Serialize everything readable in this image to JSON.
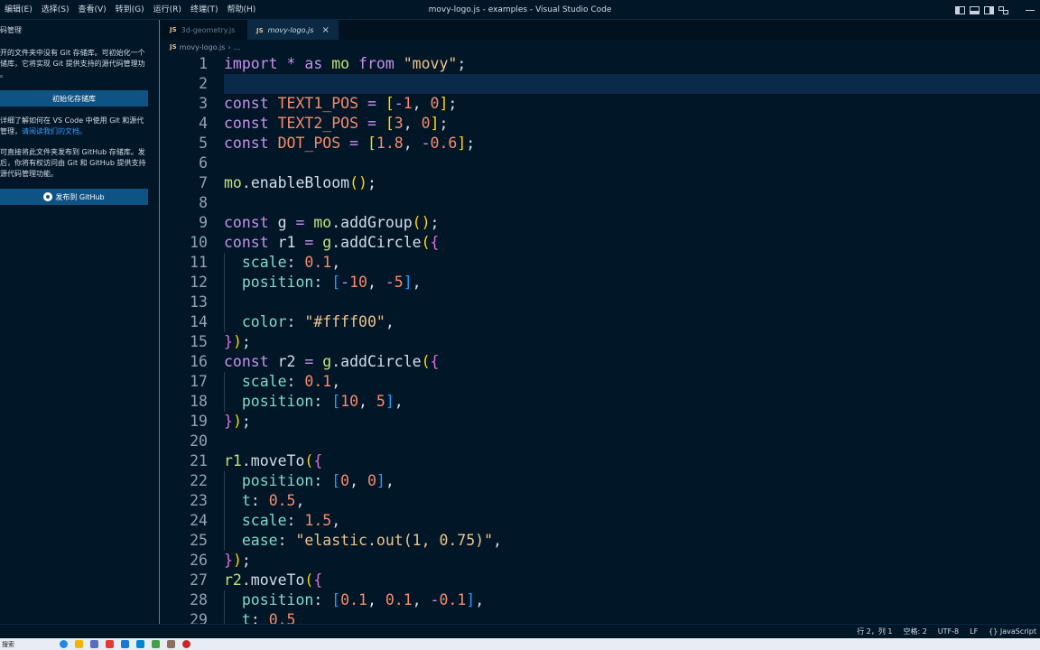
{
  "menu": [
    "编辑(E)",
    "选择(S)",
    "查看(V)",
    "转到(G)",
    "运行(R)",
    "终端(T)",
    "帮助(H)"
  ],
  "window_title": "movy-logo.js - examples - Visual Studio Code",
  "sidebar": {
    "title": "源代码管理",
    "no_repo_text": "打开的文件夹中没有 Git 存储库。可初始化一个存储库，它将实现 Git 提供支持的源代码管理功能。",
    "init_button": "初始化存储库",
    "learn_text": "要详细了解如何在 VS Code 中使用 Git 和源代码管理，",
    "learn_link": "请阅读我们的文档。",
    "publish_text": "你可直接将此文件夹发布到 GitHub 存储库。发布后，你将有权访问由 Git 和 GitHub 提供支持的源代码管理功能。",
    "publish_button": "发布到 GitHub"
  },
  "tabs": [
    {
      "label": "3d-geometry.js",
      "icon": "JS",
      "active": false
    },
    {
      "label": "movy-logo.js",
      "icon": "JS",
      "active": true
    }
  ],
  "breadcrumb": {
    "file": "movy-logo.js",
    "rest": "..."
  },
  "editor": {
    "line_numbers": [
      "1",
      "2",
      "3",
      "4",
      "5",
      "6",
      "7",
      "8",
      "9",
      "10",
      "11",
      "12",
      "13",
      "14",
      "15",
      "16",
      "17",
      "18",
      "19",
      "20",
      "21",
      "22",
      "23",
      "24",
      "25",
      "26",
      "27",
      "28",
      "29"
    ]
  },
  "statusbar": {
    "position": "行 2，列 1",
    "spaces": "空格: 2",
    "encoding": "UTF-8",
    "eol": "LF",
    "language": "{} JavaScript"
  },
  "taskbar": {
    "search": "搜索"
  },
  "colors": {
    "accent": "#0e5384",
    "background": "#011627"
  }
}
